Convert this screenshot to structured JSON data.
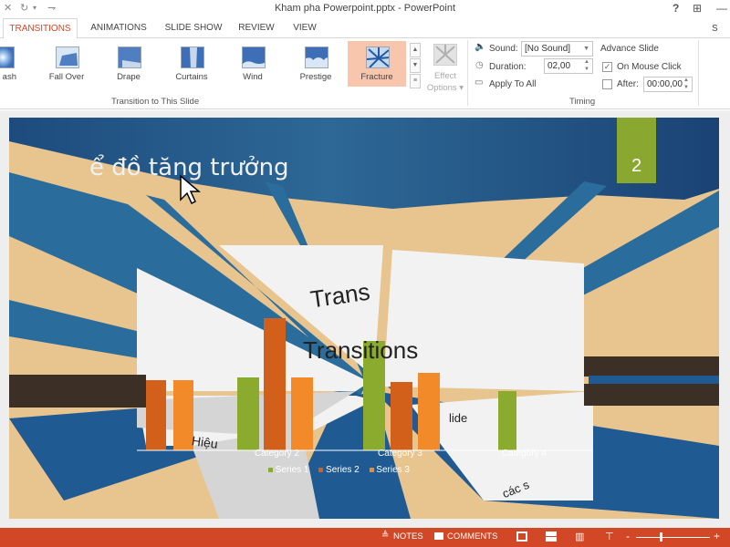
{
  "window": {
    "title": "Kham pha Powerpoint.pptx - PowerPoint",
    "help_label": "?",
    "minimize_label": "—",
    "restore_label": "⊞",
    "quick_access": {
      "close_icon": "✕",
      "redo_icon": "↻",
      "more_icon": "▾",
      "customize_icon": "⇁"
    }
  },
  "tabs": [
    {
      "label": "TRANSITIONS",
      "active": true
    },
    {
      "label": "ANIMATIONS"
    },
    {
      "label": "SLIDE SHOW"
    },
    {
      "label": "REVIEW"
    },
    {
      "label": "VIEW"
    }
  ],
  "ribbon": {
    "gallery": [
      {
        "label": "ash",
        "icon": "flash-icon"
      },
      {
        "label": "Fall Over",
        "icon": "fall-over-icon"
      },
      {
        "label": "Drape",
        "icon": "drape-icon"
      },
      {
        "label": "Curtains",
        "icon": "curtains-icon"
      },
      {
        "label": "Wind",
        "icon": "wind-icon"
      },
      {
        "label": "Prestige",
        "icon": "prestige-icon"
      },
      {
        "label": "Fracture",
        "icon": "fracture-icon",
        "selected": true
      }
    ],
    "gallery_group_label": "Transition to This Slide",
    "scroll_up": "▲",
    "scroll_down": "▼",
    "scroll_more": "≡",
    "effect_options_line1": "Effect",
    "effect_options_line2": "Options ▾",
    "timing": {
      "sound_label": "Sound:",
      "sound_value": "[No Sound]",
      "duration_label": "Duration:",
      "duration_value": "02,00",
      "apply_to_all_label": "Apply To All",
      "advance_slide_label": "Advance Slide",
      "on_mouse_click_label": "On Mouse Click",
      "on_mouse_click_checked": true,
      "after_label": "After:",
      "after_checked": false,
      "after_value": "00:00,00",
      "group_label": "Timing"
    }
  },
  "slide": {
    "title_fragment": "ể  đồ tăng trưởng",
    "number": "2",
    "inner_text_1": "Trans",
    "inner_text_2": "Transitions",
    "inner_text_3": "lide",
    "inner_text_4": "Hiệu",
    "inner_text_5": "các s",
    "chart": {
      "categories": [
        "Category 2",
        "Category 3",
        "Category 4"
      ],
      "legend": [
        "Series 1",
        "Series 2",
        "Series 3"
      ],
      "colors": {
        "series1": "#8aab2e",
        "series2": "#d2601a",
        "series3": "#f28a2a"
      }
    }
  },
  "statusbar": {
    "notes_label": "NOTES",
    "comments_label": "COMMENTS",
    "zoom_minus": "-",
    "zoom_plus": "+"
  },
  "colors": {
    "accent": "#d24726",
    "selected_gallery": "#f8c5ad",
    "slide_blue": "#1d4b7d",
    "slide_number_green": "#8aa82f",
    "wood": "#e8c48e"
  }
}
